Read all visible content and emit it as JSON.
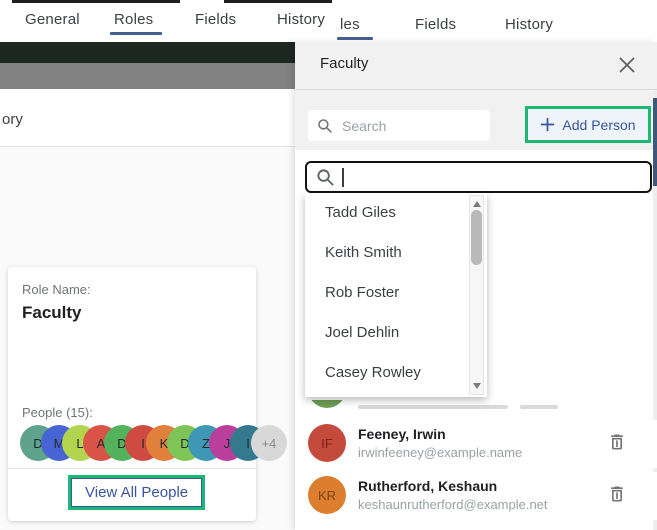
{
  "colors": {
    "accent_blue": "#3a55a0",
    "highlight_green": "#1cb873",
    "tab_underline": "#44608c",
    "panel_scroll_thumb": "#3f5878",
    "dark_toolbar": "#1c2822",
    "gray_toolbar": "#828282"
  },
  "tabs": {
    "primary": [
      {
        "label": "General",
        "active": false
      },
      {
        "label": "Roles",
        "active": true
      },
      {
        "label": "Fields",
        "active": false
      },
      {
        "label": "History",
        "active": false
      }
    ],
    "secondary": [
      {
        "label": "les",
        "active": true
      },
      {
        "label": "Fields",
        "active": false
      },
      {
        "label": "History",
        "active": false
      }
    ]
  },
  "background_window": {
    "partial_text": "ory"
  },
  "role_card": {
    "role_name_label": "Role Name:",
    "role_name": "Faculty",
    "people_label": "People (15):",
    "avatars": [
      {
        "letter": "D",
        "color": "#5fa38c"
      },
      {
        "letter": "M",
        "color": "#4763d4"
      },
      {
        "letter": "L",
        "color": "#b3d44f"
      },
      {
        "letter": "A",
        "color": "#da5349"
      },
      {
        "letter": "D",
        "color": "#54b25d"
      },
      {
        "letter": "I",
        "color": "#cf4b42"
      },
      {
        "letter": "K",
        "color": "#e0803a"
      },
      {
        "letter": "D",
        "color": "#7fc457"
      },
      {
        "letter": "Z",
        "color": "#3e97b5"
      },
      {
        "letter": "J",
        "color": "#ba3f9d"
      },
      {
        "letter": "I",
        "color": "#35798f"
      }
    ],
    "overflow_badge": "+4",
    "view_all_label": "View All People"
  },
  "panel": {
    "title": "Faculty",
    "search_placeholder": "Search",
    "add_person_label": "Add Person"
  },
  "dropdown": {
    "search_value": "",
    "items": [
      "Tadd Giles",
      "Keith Smith",
      "Rob Foster",
      "Joel Dehlin",
      "Casey Rowley"
    ]
  },
  "people": [
    {
      "initials": "IF",
      "avatar_color": "#c44b3c",
      "initials_color": "#7c201c",
      "name": "Feeney, Irwin",
      "email": "irwinfeeney@example.name"
    },
    {
      "initials": "KR",
      "avatar_color": "#dd7e2e",
      "initials_color": "#7a4512",
      "name": "Rutherford, Keshaun",
      "email": "keshaunrutherford@example.net"
    }
  ],
  "clipped_row": {
    "avatar_color": "#6d9e53"
  }
}
